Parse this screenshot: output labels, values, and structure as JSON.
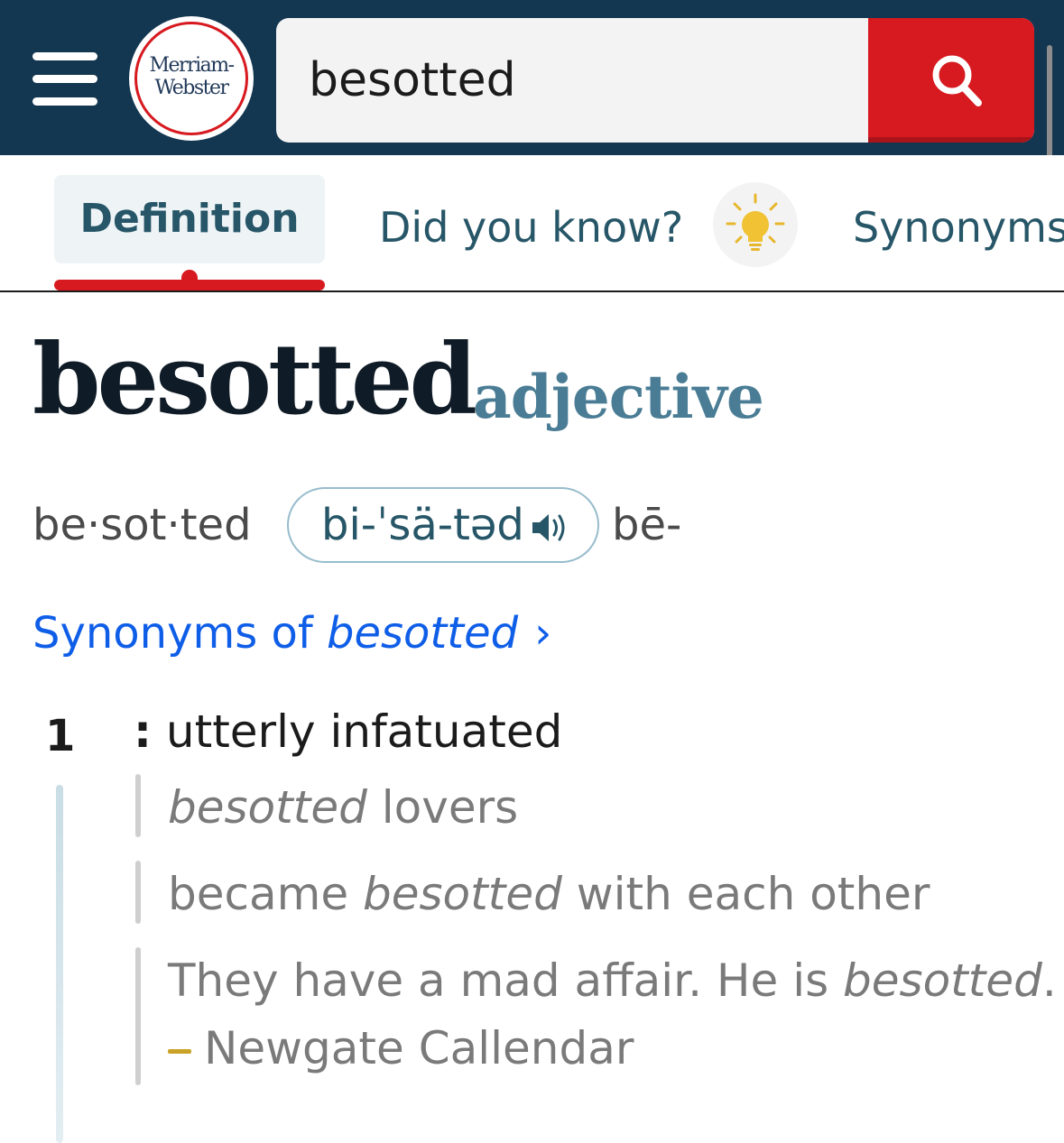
{
  "header": {
    "logo_line1": "Merriam-",
    "logo_line2": "Webster",
    "search_value": "besotted"
  },
  "tabs": {
    "definition": "Definition",
    "did_you_know": "Did you know?",
    "synonyms": "Synonyms"
  },
  "entry": {
    "headword": "besotted",
    "part_of_speech": "adjective",
    "syllables": "be·sot·ted",
    "pronunciation": "bi-ˈsä-təd",
    "pronunciation_alt": "bē-",
    "synonyms_link_prefix": "Synonyms of ",
    "synonyms_link_word": "besotted",
    "synonyms_link_arrow": "›",
    "sense_number": "1",
    "definition_colon": ":",
    "definition_text": " utterly infatuated",
    "example1_italic": "besotted",
    "example1_rest": " lovers",
    "example2_start": "became ",
    "example2_italic": "besotted",
    "example2_end": " with each other",
    "example3_start": "They have a mad affair. He is ",
    "example3_italic": "besotted",
    "example3_end": ".",
    "example3_source": "Newgate Callendar"
  },
  "colors": {
    "header_bg": "#133751",
    "brand_red": "#d71920",
    "tab_text": "#265667",
    "link_blue": "#0f5ee8",
    "pos_blue": "#4a7d95"
  },
  "icons": {
    "menu": "hamburger-menu-icon",
    "search": "magnifier-icon",
    "did_you_know": "lightbulb-icon",
    "audio": "speaker-icon"
  }
}
